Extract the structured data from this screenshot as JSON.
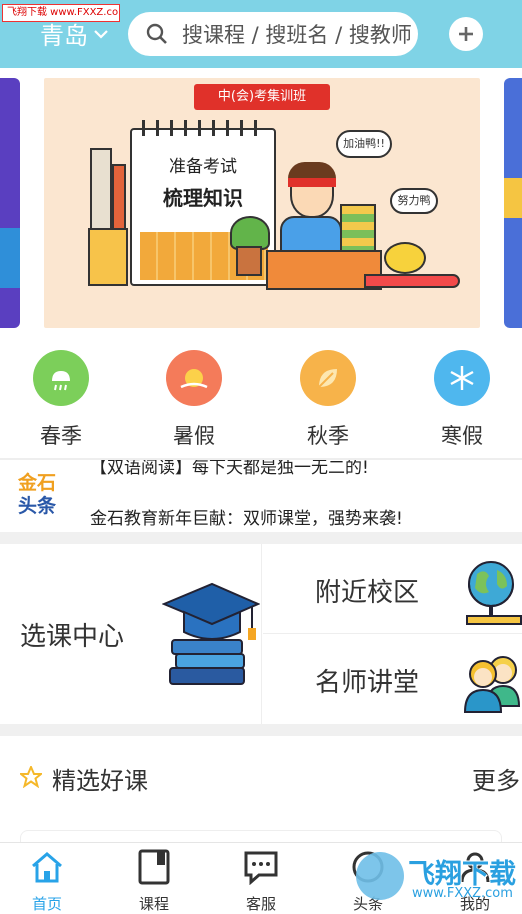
{
  "watermark_top": "飞翔下载 www.FXXZ.com",
  "header": {
    "city": "青岛",
    "search_placeholder": "搜课程 / 搜班名 / 搜教师"
  },
  "banner": {
    "tag": "中(会)考集训班",
    "calendar_line1": "准备考试",
    "calendar_line2": "梳理知识",
    "bubble1": "加油鸭!!",
    "bubble2": "努力鸭"
  },
  "seasons": [
    {
      "label": "春季",
      "color": "#7ccf5a"
    },
    {
      "label": "暑假",
      "color": "#f47b5a"
    },
    {
      "label": "秋季",
      "color": "#f7b34a"
    },
    {
      "label": "寒假",
      "color": "#4fb7ee"
    }
  ],
  "news": {
    "logo_line1": "金石",
    "logo_line2": "头条",
    "items": [
      "【双语阅读】每下天都是独一无二的!",
      "金石教育新年巨献：双师课堂，强势来袭!"
    ]
  },
  "entries": {
    "main": "选课中心",
    "nearby": "附近校区",
    "teachers": "名师讲堂"
  },
  "featured": {
    "title": "精选好课",
    "more": "更多"
  },
  "tabs": [
    {
      "label": "首页",
      "icon": "home-icon",
      "active": true
    },
    {
      "label": "课程",
      "icon": "book-icon",
      "active": false
    },
    {
      "label": "客服",
      "icon": "chat-icon",
      "active": false
    },
    {
      "label": "头条",
      "icon": "news-icon",
      "active": false
    },
    {
      "label": "我的",
      "icon": "user-icon",
      "active": false
    }
  ],
  "watermark_bottom": {
    "brand": "飞翔下载",
    "url": "www.FXXZ.com"
  },
  "colors": {
    "header_bg": "#7fd3e6",
    "active_tab": "#28a3e8"
  }
}
